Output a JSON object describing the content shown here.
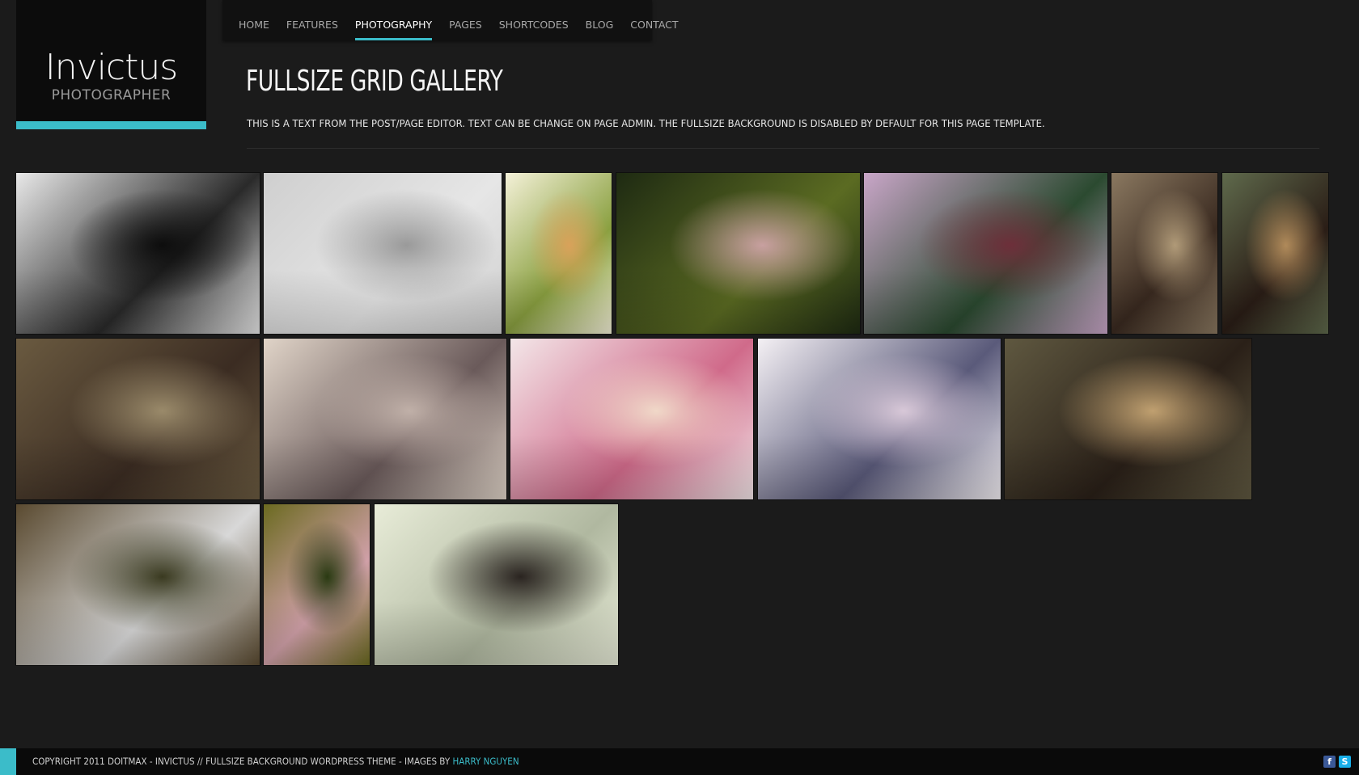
{
  "logo": {
    "title": "Invictus",
    "subtitle": "PHOTOGRAPHER"
  },
  "nav": {
    "items": [
      "HOME",
      "FEATURES",
      "PHOTOGRAPHY",
      "PAGES",
      "SHORTCODES",
      "BLOG",
      "CONTACT"
    ],
    "active": "PHOTOGRAPHY"
  },
  "page": {
    "title": "FULLSIZE GRID GALLERY",
    "intro": "THIS IS A TEXT FROM THE POST/PAGE EDITOR. TEXT CAN BE CHANGE ON PAGE ADMIN. THE FULLSIZE BACKGROUND IS DISABLED BY DEFAULT FOR THIS PAGE TEMPLATE."
  },
  "gallery": {
    "photos": [
      {
        "name": "photo-bw-feathers",
        "colors": [
          "#e8e8e8",
          "#2a2a2a",
          "#0d0d0d"
        ]
      },
      {
        "name": "photo-white-hat",
        "colors": [
          "#cfcfcf",
          "#e6e6e6",
          "#9a9a9a"
        ]
      },
      {
        "name": "photo-park-sitting",
        "colors": [
          "#f4f1d8",
          "#8aa040",
          "#d9a25a"
        ]
      },
      {
        "name": "photo-forest-sunglasses",
        "colors": [
          "#1e2a12",
          "#5b6b22",
          "#c8a0a0"
        ]
      },
      {
        "name": "photo-floral-dress",
        "colors": [
          "#c9a6c8",
          "#2b4a30",
          "#6d2f3a"
        ]
      },
      {
        "name": "photo-wallpaper-posing",
        "colors": [
          "#8a7860",
          "#3a2a20",
          "#b09a78"
        ]
      },
      {
        "name": "photo-leopard-earrings",
        "colors": [
          "#5f6a4c",
          "#2a1d16",
          "#b08a5a"
        ]
      },
      {
        "name": "photo-plaid-shirt",
        "colors": [
          "#6a5a40",
          "#3b2c22",
          "#9a8a6a"
        ]
      },
      {
        "name": "photo-man-railing",
        "colors": [
          "#e0d4c8",
          "#6a5a5a",
          "#c0b0a8"
        ]
      },
      {
        "name": "photo-mirror-pink",
        "colors": [
          "#f3e6e8",
          "#d06a8a",
          "#f0d8c8"
        ]
      },
      {
        "name": "photo-man-balcony",
        "colors": [
          "#f4f0f4",
          "#5a5a7a",
          "#d8c8d8"
        ]
      },
      {
        "name": "photo-leopard-chair",
        "colors": [
          "#5f5840",
          "#2a2018",
          "#c0a070"
        ]
      },
      {
        "name": "photo-man-lying",
        "colors": [
          "#5a4a30",
          "#d8d8d8",
          "#3a3a20"
        ]
      },
      {
        "name": "photo-forest-pink",
        "colors": [
          "#6b6a20",
          "#d0a0a8",
          "#2a3a12"
        ]
      },
      {
        "name": "photo-white-back",
        "colors": [
          "#e8ecd8",
          "#b0b8a0",
          "#2a2420"
        ]
      }
    ]
  },
  "footer": {
    "copyright": "COPYRIGHT 2011 DOITMAX - INVICTUS // FULLSIZE BACKGROUND WORDPRESS THEME - IMAGES BY",
    "credit_link": "HARRY NGUYEN",
    "social": {
      "facebook": "f",
      "skype": "S"
    }
  },
  "colors": {
    "accent": "#3bbcc9",
    "background": "#1b1b1b"
  }
}
